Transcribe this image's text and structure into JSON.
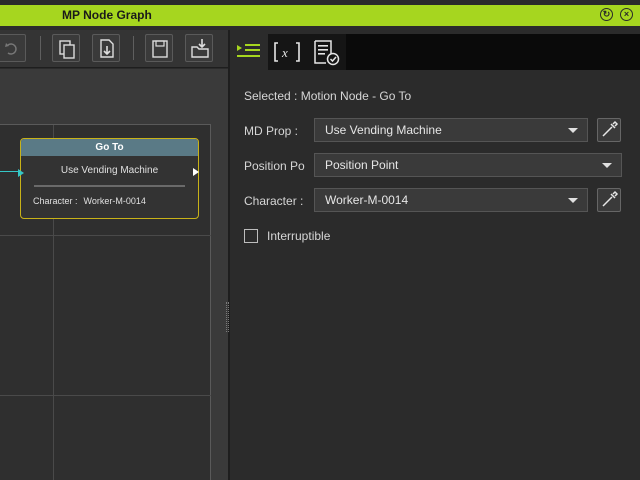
{
  "window": {
    "title": "MP Node Graph",
    "accent": "#a6d61f",
    "controls": [
      "restore-icon",
      "close-icon"
    ]
  },
  "toolbar": {
    "icons": [
      "undo-icon",
      "copy-icon",
      "import-icon",
      "save-icon",
      "load-icon"
    ]
  },
  "node": {
    "title": "Go To",
    "motion": "Use Vending Machine",
    "character_label": "Character :",
    "character_value": "Worker-M-0014",
    "header_color": "#5a7a86",
    "border_color": "#c8b218"
  },
  "panel": {
    "tabs": [
      "properties-tab-icon",
      "variables-tab-icon",
      "checklist-tab-icon"
    ],
    "selected": "Selected : Motion Node - Go To",
    "fields": {
      "md_prop": {
        "label": "MD Prop :",
        "value": "Use Vending Machine"
      },
      "position": {
        "label": "Position Po",
        "value": "Position Point"
      },
      "character": {
        "label": "Character :",
        "value": "Worker-M-0014"
      }
    },
    "interruptible": {
      "label": "Interruptible",
      "checked": false
    }
  }
}
